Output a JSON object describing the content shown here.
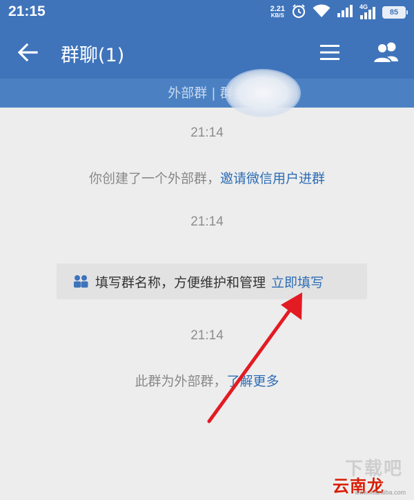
{
  "status_bar": {
    "time": "21:15",
    "net_speed_value": "2.21",
    "net_speed_unit": "KB/S",
    "alarm_icon": "alarm-icon",
    "wifi_icon": "wifi-icon",
    "signal_icon": "signal-icon",
    "network_type": "4G",
    "battery_level": "85"
  },
  "navbar": {
    "title": "群聊(1)",
    "back_icon": "back-arrow-icon",
    "menu_icon": "menu-icon",
    "members_icon": "group-members-icon",
    "bg_color": "#3f74bb"
  },
  "banner": {
    "text": "外部群 | 群主"
  },
  "messages": {
    "time_1": "21:14",
    "created_text": "你创建了一个外部群，",
    "invite_link": "邀请微信用户进群",
    "time_2": "21:14",
    "fill_prompt": "填写群名称，方便维护和管理",
    "fill_link": "立即填写",
    "time_3": "21:14",
    "external_text": "此群为外部群，",
    "learn_more_link": "了解更多"
  },
  "colors": {
    "link": "#2d6db5",
    "annotation_arrow": "#e31b23"
  },
  "watermark": {
    "top_text": "下载吧",
    "main_text": "云南龙网",
    "url_text": "www.xiazaiba.com"
  }
}
